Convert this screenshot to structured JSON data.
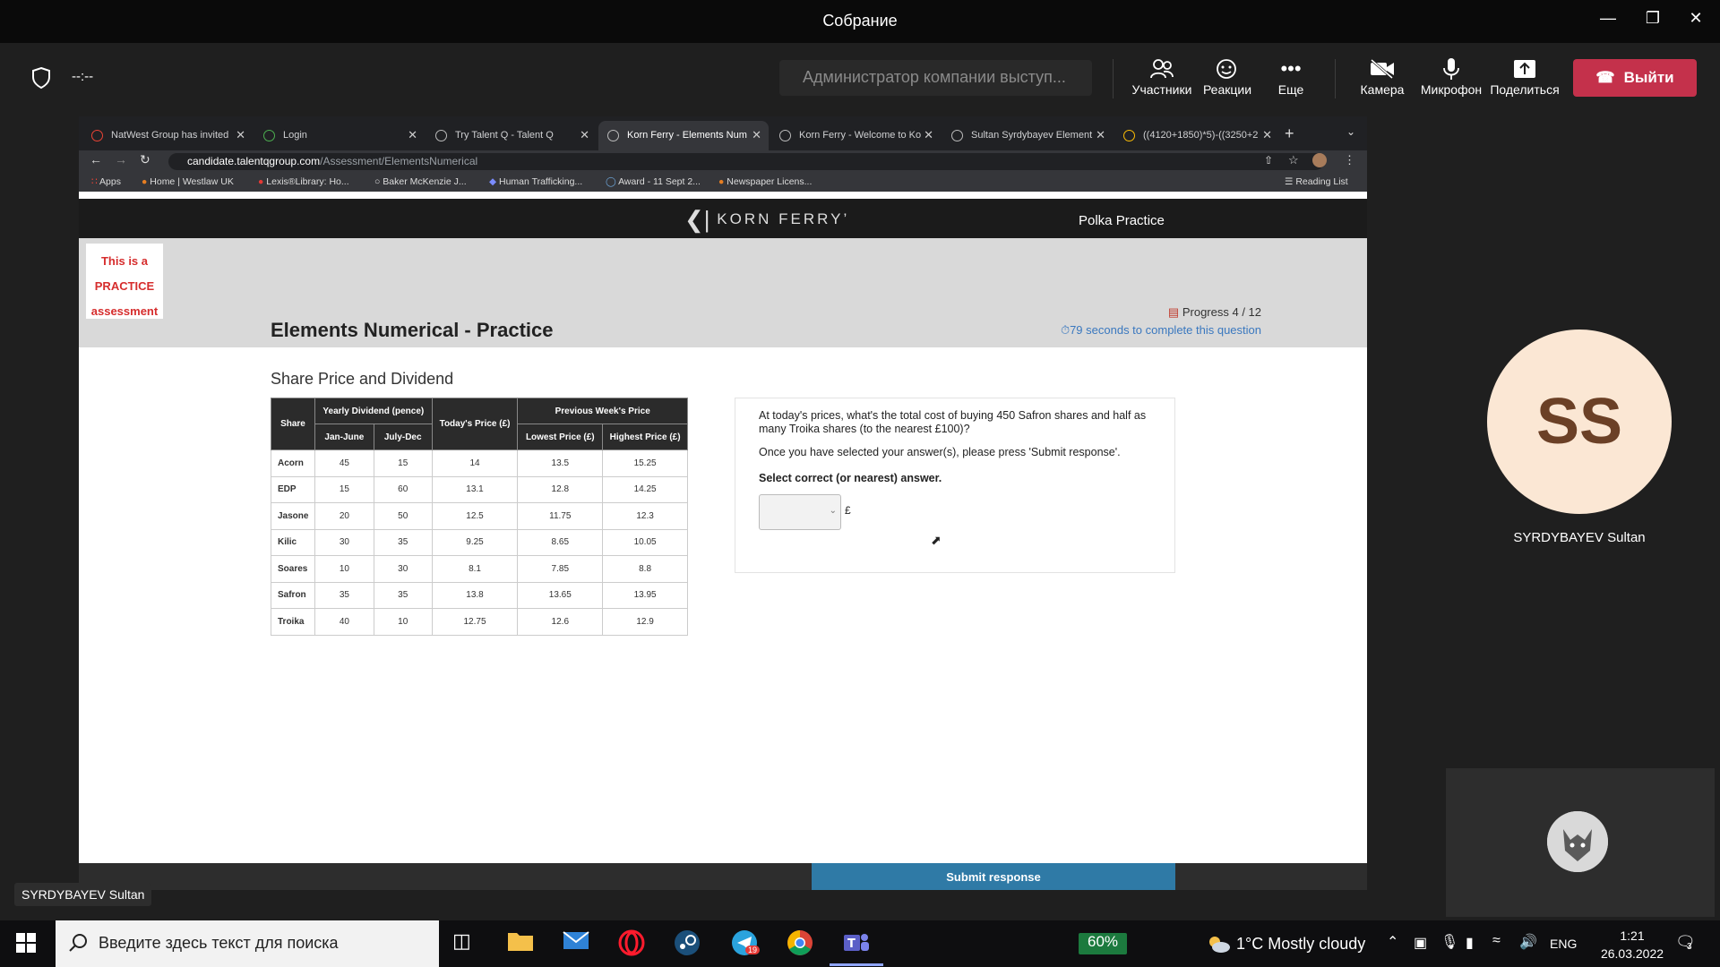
{
  "meeting": {
    "title": "Собрание",
    "timer": "--:--",
    "presenter_text": "Администратор компании выступ...",
    "toolbar": [
      {
        "label": "Участники",
        "icon": "participants-icon"
      },
      {
        "label": "Реакции",
        "icon": "reactions-icon"
      },
      {
        "label": "Еще",
        "icon": "more-icon"
      },
      {
        "label": "Камера",
        "icon": "camera-off-icon"
      },
      {
        "label": "Микрофон",
        "icon": "microphone-icon"
      },
      {
        "label": "Поделиться",
        "icon": "share-icon"
      }
    ],
    "leave_label": "Выйти",
    "participant": {
      "initials": "SS",
      "name": "SYRDYBAYEV Sultan"
    },
    "name_pill": "SYRDYBAYEV Sultan"
  },
  "browser": {
    "tabs": [
      {
        "label": "NatWest Group has invited"
      },
      {
        "label": "Login"
      },
      {
        "label": "Try Talent Q - Talent Q"
      },
      {
        "label": "Korn Ferry - Elements Num"
      },
      {
        "label": "Korn Ferry - Welcome to Ko"
      },
      {
        "label": "Sultan Syrdybayev Element"
      },
      {
        "label": "((4120+1850)*5)-((3250+2"
      }
    ],
    "url_host": "candidate.talentqgroup.com",
    "url_path": "/Assessment/ElementsNumerical",
    "bookmarks": [
      "Apps",
      "Home | Westlaw UK",
      "Lexis®Library: Ho...",
      "Baker McKenzie J...",
      "Human Trafficking...",
      "Award - 11 Sept 2...",
      "Newspaper Licens...",
      "Reading List"
    ]
  },
  "assessment": {
    "brand": "KORN FERRY",
    "practice_name": "Polka Practice",
    "practice_badge": [
      "This is a",
      "PRACTICE",
      "assessment"
    ],
    "title": "Elements Numerical - Practice",
    "progress": "Progress 4 / 12",
    "timer": "79 seconds to complete this question",
    "question_title": "Share Price and Dividend",
    "table": {
      "h_share": "Share",
      "h_dividend": "Yearly Dividend (pence)",
      "h_today": "Today's Price (£)",
      "h_prev": "Previous Week's Price",
      "h_jan": "Jan-June",
      "h_jul": "July-Dec",
      "h_low": "Lowest Price (£)",
      "h_high": "Highest Price (£)",
      "rows": [
        [
          "Acorn",
          "45",
          "15",
          "14",
          "13.5",
          "15.25"
        ],
        [
          "EDP",
          "15",
          "60",
          "13.1",
          "12.8",
          "14.25"
        ],
        [
          "Jasone",
          "20",
          "50",
          "12.5",
          "11.75",
          "12.3"
        ],
        [
          "Kilic",
          "30",
          "35",
          "9.25",
          "8.65",
          "10.05"
        ],
        [
          "Soares",
          "10",
          "30",
          "8.1",
          "7.85",
          "8.8"
        ],
        [
          "Safron",
          "35",
          "35",
          "13.8",
          "13.65",
          "13.95"
        ],
        [
          "Troika",
          "40",
          "10",
          "12.75",
          "12.6",
          "12.9"
        ]
      ]
    },
    "question_text": "At today's prices, what's the total cost of buying 450 Safron shares and half as many Troika shares (to the nearest £100)?",
    "instruction": "Once you have selected your answer(s), please press 'Submit response'.",
    "select_label": "Select correct (or nearest) answer.",
    "currency": "£",
    "submit_label": "Submit response"
  },
  "taskbar": {
    "search_placeholder": "Введите здесь текст для поиска",
    "battery": "60%",
    "weather": "1°C  Mostly cloudy",
    "lang": "ENG",
    "time": "1:21",
    "date": "26.03.2022",
    "telegram_badge": "19",
    "notifications": "3"
  }
}
